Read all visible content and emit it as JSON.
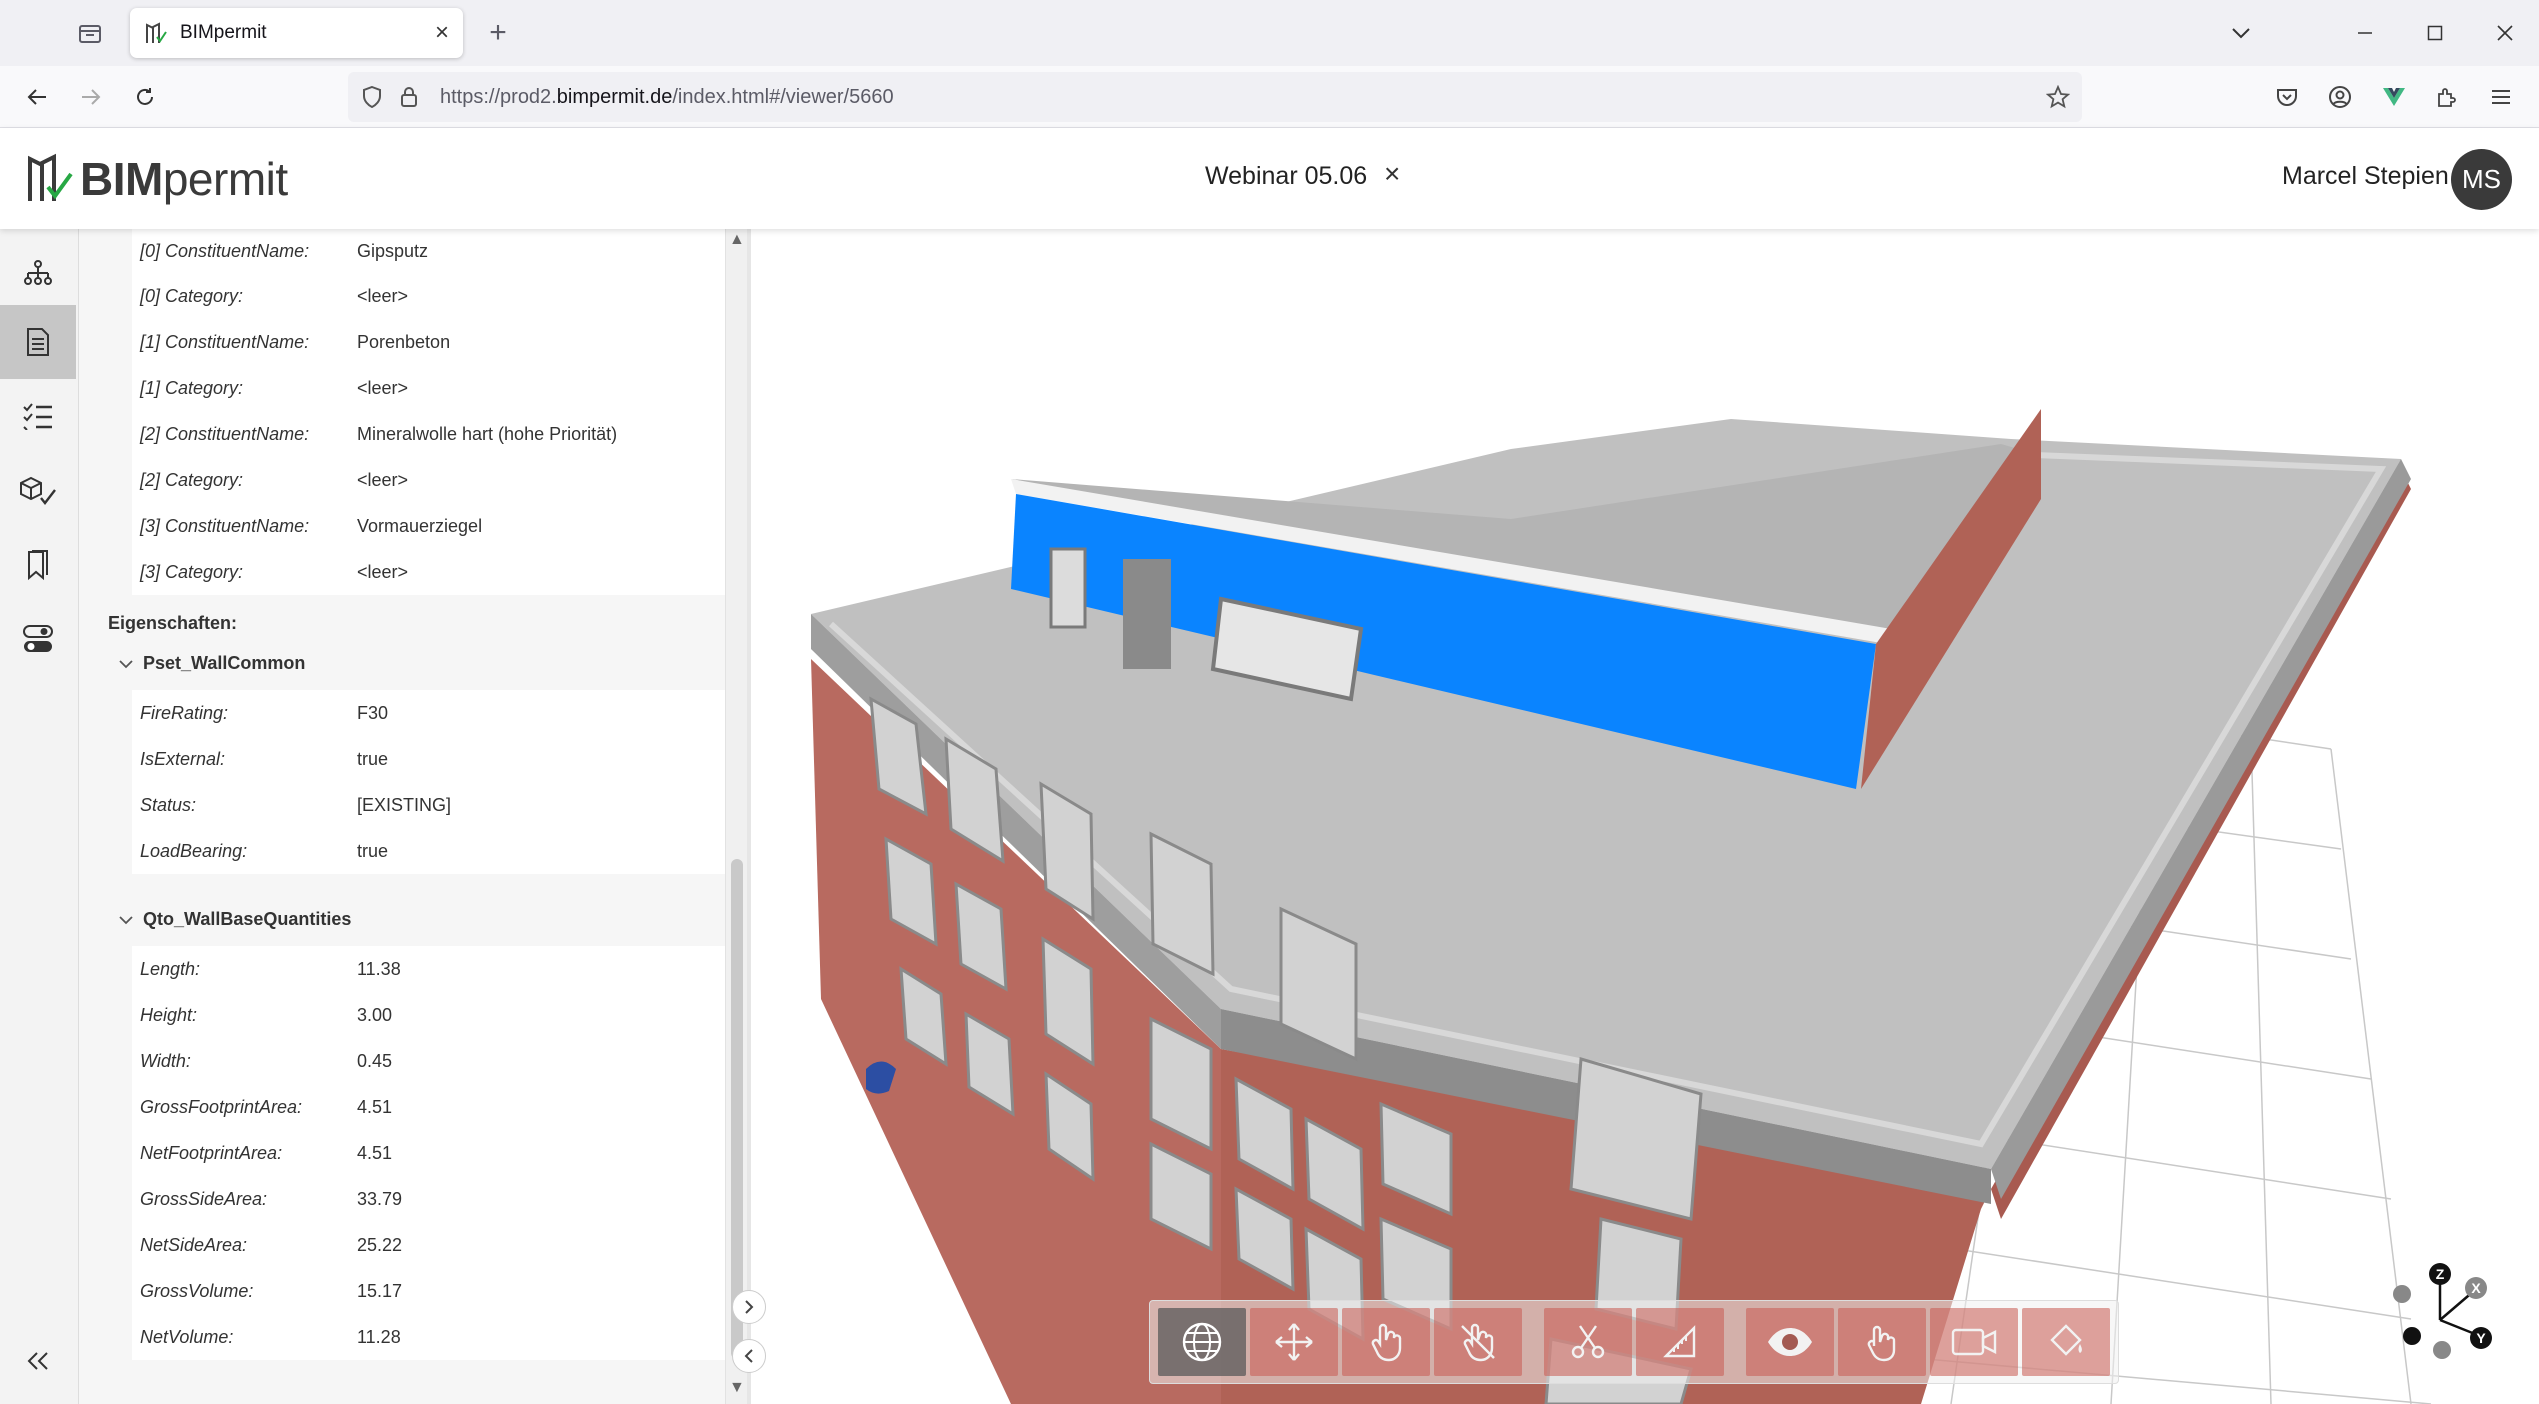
{
  "browser": {
    "tab_title": "BIMpermit",
    "url_prefix": "https://prod2.",
    "url_domain": "bimpermit.de",
    "url_path": "/index.html#/viewer/5660"
  },
  "header": {
    "logo_bold": "BIM",
    "logo_light": "permit",
    "project_title": "Webinar 05.06",
    "close_glyph": "×",
    "user_name": "Marcel Stepien",
    "user_initials": "MS"
  },
  "panel": {
    "constituents": [
      {
        "key": "[0] ConstituentName:",
        "value": "Gipsputz"
      },
      {
        "key": "[0] Category:",
        "value": "<leer>"
      },
      {
        "key": "[1] ConstituentName:",
        "value": "Porenbeton"
      },
      {
        "key": "[1] Category:",
        "value": "<leer>"
      },
      {
        "key": "[2] ConstituentName:",
        "value": "Mineralwolle hart (hohe Priorität)"
      },
      {
        "key": "[2] Category:",
        "value": "<leer>"
      },
      {
        "key": "[3] ConstituentName:",
        "value": "Vormauerziegel"
      },
      {
        "key": "[3] Category:",
        "value": "<leer>"
      }
    ],
    "properties_label": "Eigenschaften:",
    "pset_wall_common": {
      "title": "Pset_WallCommon",
      "rows": [
        {
          "key": "FireRating:",
          "value": "F30"
        },
        {
          "key": "IsExternal:",
          "value": "true"
        },
        {
          "key": "Status:",
          "value": "[EXISTING]"
        },
        {
          "key": "LoadBearing:",
          "value": "true"
        }
      ]
    },
    "qto_wall": {
      "title": "Qto_WallBaseQuantities",
      "rows": [
        {
          "key": "Length:",
          "value": "11.38"
        },
        {
          "key": "Height:",
          "value": "3.00"
        },
        {
          "key": "Width:",
          "value": "0.45"
        },
        {
          "key": "GrossFootprintArea:",
          "value": "4.51"
        },
        {
          "key": "NetFootprintArea:",
          "value": "4.51"
        },
        {
          "key": "GrossSideArea:",
          "value": "33.79"
        },
        {
          "key": "NetSideArea:",
          "value": "25.22"
        },
        {
          "key": "GrossVolume:",
          "value": "15.17"
        },
        {
          "key": "NetVolume:",
          "value": "11.28"
        }
      ]
    }
  },
  "rail_icons": [
    "hierarchy-icon",
    "properties-document-icon",
    "checklist-icon",
    "model-check-icon",
    "bookmark-icon",
    "toggles-icon"
  ],
  "toolbar_icons": [
    "globe-icon",
    "pan-icon",
    "select-hand-icon",
    "hide-hand-icon",
    "section-cut-icon",
    "measure-ruler-icon",
    "visibility-eye-icon",
    "touch-rotate-icon",
    "camera-icon",
    "paint-bucket-icon"
  ],
  "gizmo": {
    "x": "X",
    "y": "Y",
    "z": "Z"
  },
  "colors": {
    "wall_selected": "#0a84ff",
    "brick": "#b86a60",
    "roof": "#b9b9b9",
    "accent_dark": "#3a3a3a"
  }
}
